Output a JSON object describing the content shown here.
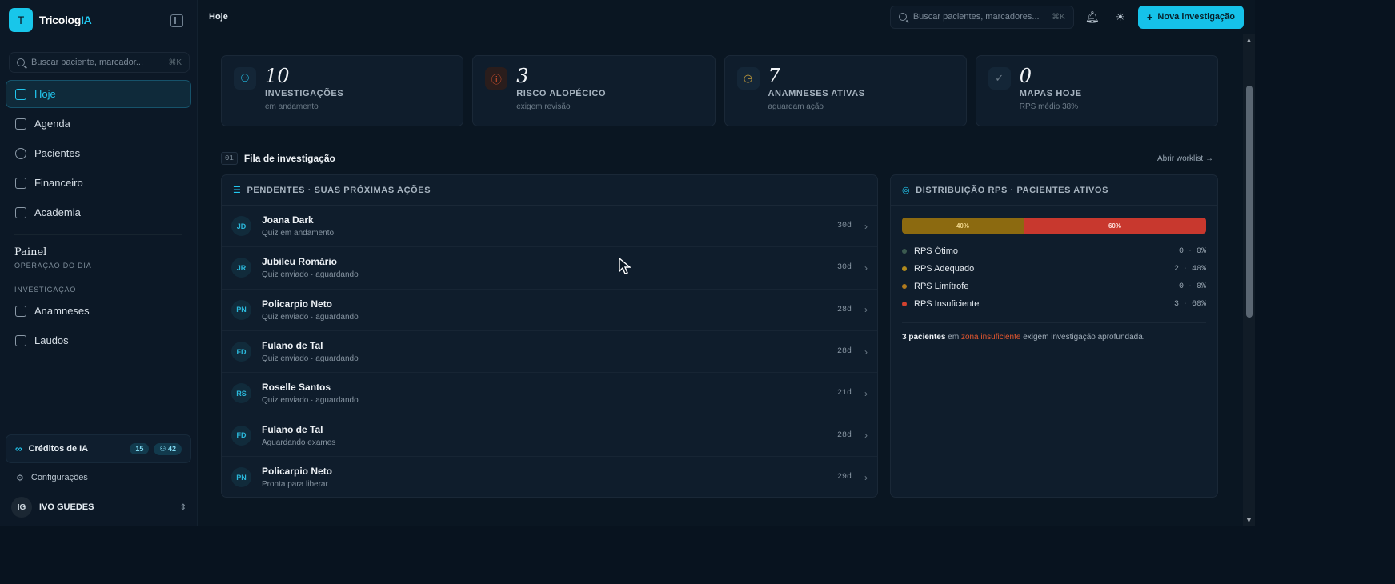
{
  "brand": {
    "logo_letter": "T",
    "name_prefix": "Tricolog",
    "name_suffix": "IA"
  },
  "sidebar": {
    "search_placeholder": "Buscar paciente, marcador...",
    "search_shortcut": "⌘K",
    "nav": [
      {
        "label": "Hoje",
        "icon": "dashboard-icon",
        "active": true
      },
      {
        "label": "Agenda",
        "icon": "calendar-icon"
      },
      {
        "label": "Pacientes",
        "icon": "users-icon"
      },
      {
        "label": "Financeiro",
        "icon": "wallet-icon"
      },
      {
        "label": "Academia",
        "icon": "graduation-cap-icon"
      }
    ],
    "painel_title": "Painel",
    "painel_subtitle": "OPERAÇÃO DO DIA",
    "investigacao_label": "INVESTIGAÇÃO",
    "inv_items": [
      {
        "label": "Anamneses",
        "icon": "clipboard-icon"
      },
      {
        "label": "Laudos",
        "icon": "document-icon"
      }
    ],
    "credits_label": "Créditos de IA",
    "credits_badge_1": "15",
    "credits_badge_2": "42",
    "settings_label": "Configurações",
    "user_initials": "IG",
    "user_name": "IVO GUEDES"
  },
  "topbar": {
    "breadcrumb": "Hoje",
    "search_placeholder": "Buscar pacientes, marcadores...",
    "search_shortcut": "⌘K",
    "new_button": "Nova investigação"
  },
  "stats": [
    {
      "value": "10",
      "label": "INVESTIGAÇÕES",
      "sub": "em andamento",
      "icon": "users-icon"
    },
    {
      "value": "3",
      "label": "RISCO ALOPÉCICO",
      "sub": "exigem revisão",
      "icon": "alert-icon"
    },
    {
      "value": "7",
      "label": "ANAMNESES ATIVAS",
      "sub": "aguardam ação",
      "icon": "clock-icon"
    },
    {
      "value": "0",
      "label": "MAPAS HOJE",
      "sub": "RPS médio 38%",
      "icon": "check-circle-icon"
    }
  ],
  "section": {
    "number": "01",
    "title": "Fila de investigação",
    "link": "Abrir worklist →"
  },
  "queue": {
    "title": "PENDENTES · SUAS PRÓXIMAS AÇÕES",
    "rows": [
      {
        "initials": "JD",
        "name": "Joana Dark",
        "status": "Quiz em andamento",
        "days": "30d"
      },
      {
        "initials": "JR",
        "name": "Jubileu Romário",
        "status": "Quiz enviado · aguardando",
        "days": "30d"
      },
      {
        "initials": "PN",
        "name": "Policarpio Neto",
        "status": "Quiz enviado · aguardando",
        "days": "28d"
      },
      {
        "initials": "FD",
        "name": "Fulano de Tal",
        "status": "Quiz enviado · aguardando",
        "days": "28d"
      },
      {
        "initials": "RS",
        "name": "Roselle Santos",
        "status": "Quiz enviado · aguardando",
        "days": "21d"
      },
      {
        "initials": "FD",
        "name": "Fulano de Tal",
        "status": "Aguardando exames",
        "days": "28d"
      },
      {
        "initials": "PN",
        "name": "Policarpio Neto",
        "status": "Pronta para liberar",
        "days": "29d"
      }
    ]
  },
  "distribution": {
    "title": "DISTRIBUIÇÃO RPS · PACIENTES ATIVOS",
    "bar": {
      "adequado_label": "40%",
      "adequado_fraction": 0.4,
      "insuficiente_label": "60%",
      "insuficiente_fraction": 0.6
    },
    "legend": [
      {
        "label": "RPS Ótimo",
        "count": "0",
        "pct": "0%",
        "color": "#3b5a4f"
      },
      {
        "label": "RPS Adequado",
        "count": "2",
        "pct": "40%",
        "color": "#b08a1d"
      },
      {
        "label": "RPS Limítrofe",
        "count": "0",
        "pct": "0%",
        "color": "#b07a1d"
      },
      {
        "label": "RPS Insuficiente",
        "count": "3",
        "pct": "60%",
        "color": "#d2422f"
      }
    ],
    "note_bold": "3 pacientes",
    "note_pre": " em ",
    "note_highlight": "zona insuficiente",
    "note_post": " exigem investigação aprofundada."
  },
  "colors": {
    "accent": "#15c2ea",
    "danger": "#e5572f",
    "warning": "#b08a1d"
  }
}
